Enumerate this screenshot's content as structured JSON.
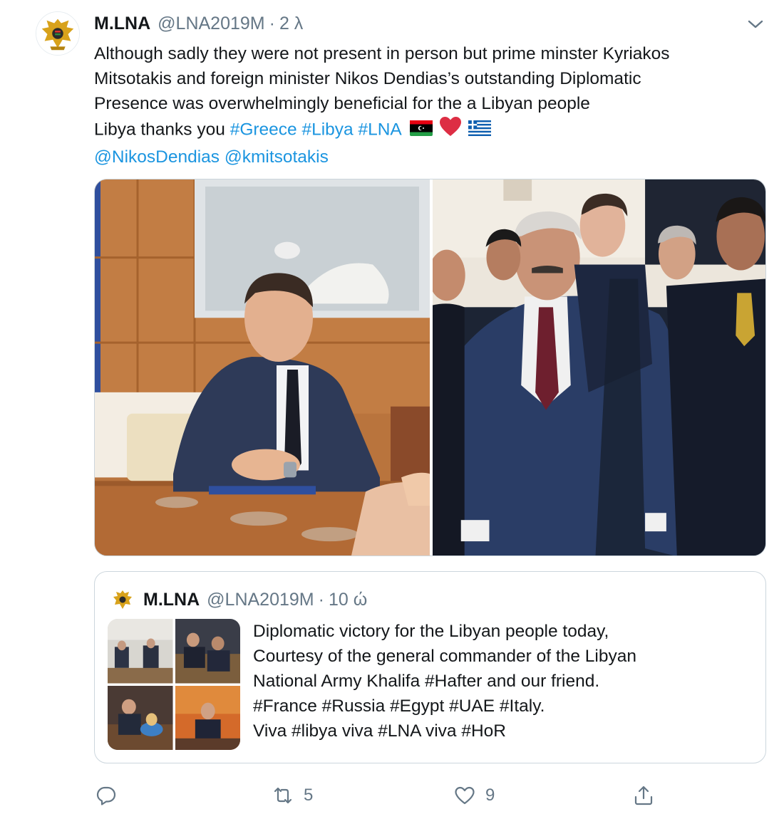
{
  "tweet": {
    "name": "M.LNA",
    "handle": "@LNA2019M",
    "separator": "·",
    "time": "2 λ",
    "text_lines": [
      "Although sadly they were not present in person but prime minster Kyriakos",
      "Mitsotakis and foreign minister Nikos Dendias’s outstanding Diplomatic",
      "Presence was overwhelmingly beneficial for the a Libyan people"
    ],
    "line4_prefix": "Libya thanks you",
    "hashtags": [
      "#Greece",
      "#Libya",
      "#LNA"
    ],
    "emojis": [
      "libya-flag-icon",
      "red-heart-icon",
      "greece-flag-icon"
    ],
    "mentions": [
      "@NikosDendias",
      "@kmitsotakis"
    ],
    "media_count": 2
  },
  "quote": {
    "name": "M.LNA",
    "handle": "@LNA2019M",
    "separator": "·",
    "time": "10 ώ",
    "text_lines": [
      "Diplomatic victory for the Libyan people today,",
      "Courtesy of the general commander of the Libyan",
      "National Army Khalifa #Hafter and our friend.",
      "#France #Russia #Egypt #UAE #Italy.",
      "Viva #libya viva #LNA viva #HoR"
    ],
    "thumbnail_count": 4
  },
  "actions": {
    "reply_icon": "reply-icon",
    "retweet_icon": "retweet-icon",
    "retweet_count": "5",
    "like_icon": "heart-icon",
    "like_count": "9",
    "share_icon": "share-icon"
  },
  "colors": {
    "link": "#1b95e0",
    "secondary_text": "#657786",
    "primary_text": "#14171a",
    "border": "#ccd6dd"
  }
}
